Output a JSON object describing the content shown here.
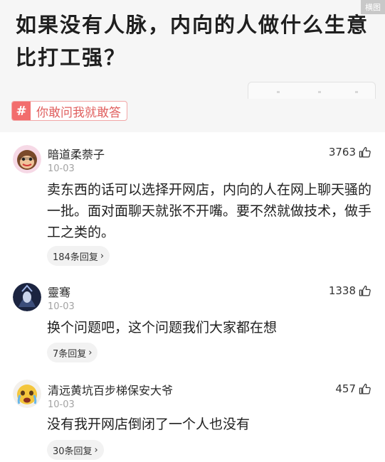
{
  "header": {
    "corner_tag": "横图",
    "title": "如果没有人脉，内向的人做什么生意比打工强？",
    "topic_chip": {
      "icon": "hash-icon",
      "label": "你敢问我就敢答"
    }
  },
  "colors": {
    "accent": "#f26d6d",
    "muted": "#a3a3a3",
    "reply_bg": "#f2f2f2"
  },
  "comments": [
    {
      "name": "暗道柔萘子",
      "date": "10-03",
      "likes": "3763",
      "content": "卖东西的话可以选择开网店，内向的人在网上聊天骚的一批。面对面聊天就张不开嘴。要不然就做技术，做手工之类的。",
      "replies": "184条回复"
    },
    {
      "name": "靈骞",
      "date": "10-03",
      "likes": "1338",
      "content": "换个问题吧，这个问题我们大家都在想",
      "replies": "7条回复"
    },
    {
      "name": "清远黄坑百步梯保安大爷",
      "date": "10-03",
      "likes": "457",
      "content": "没有我开网店倒闭了一个人也没有",
      "replies": "30条回复"
    }
  ]
}
